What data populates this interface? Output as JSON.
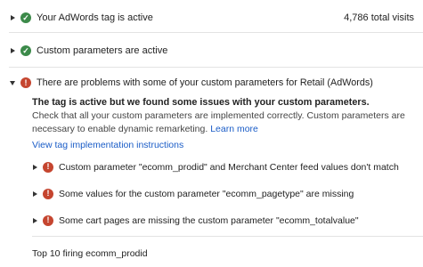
{
  "rows": {
    "tag": {
      "label": "Your AdWords tag is active",
      "stat": "4,786 total visits"
    },
    "params": {
      "label": "Custom parameters are active"
    },
    "problems": {
      "label": "There are problems with some of your custom parameters for Retail (AdWords)"
    }
  },
  "detail": {
    "heading": "The tag is active but we found some issues with your custom parameters.",
    "body": "Check that all your custom parameters are implemented correctly. Custom parameters are necessary to enable dynamic remarketing.",
    "learn_more": "Learn more",
    "view_instructions": "View tag implementation instructions"
  },
  "issues": [
    {
      "label": "Custom parameter \"ecomm_prodid\" and Merchant Center feed values don't match"
    },
    {
      "label": "Some values for the custom parameter \"ecomm_pagetype\" are missing"
    },
    {
      "label": "Some cart pages are missing the custom parameter \"ecomm_totalvalue\""
    }
  ],
  "footer": {
    "label": "Top 10 firing ecomm_prodid"
  },
  "icons": {
    "ok": "check-circle-icon",
    "error": "exclamation-circle-icon",
    "ok_color": "#3c8a4a",
    "error_color": "#c5452f"
  }
}
